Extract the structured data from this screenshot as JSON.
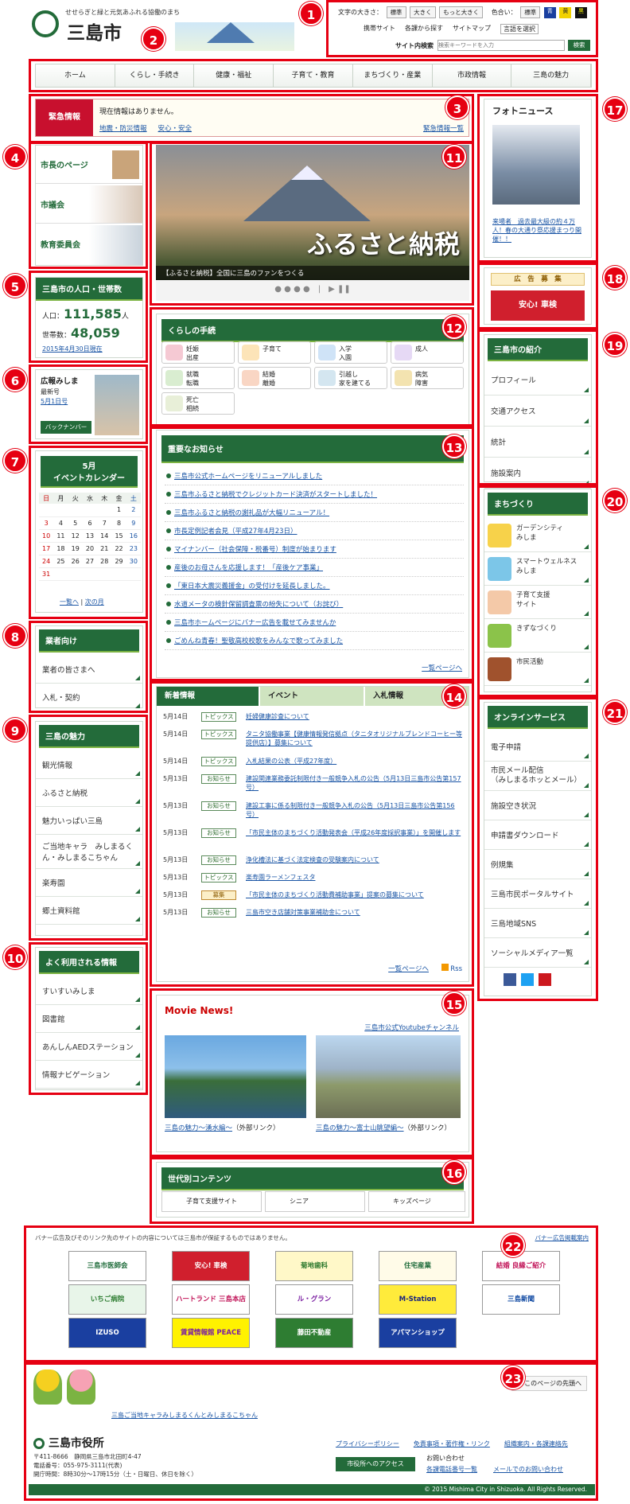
{
  "header": {
    "tagline": "せせらぎと緑と元気あふれる協働のまち",
    "site_name": "三島市",
    "font_size_label": "文字の大きさ：",
    "font_buttons": [
      "標準",
      "大きく",
      "もっと大きく"
    ],
    "color_label": "色合い：",
    "color_buttons": [
      "標準",
      "青",
      "黄",
      "黒"
    ],
    "links": [
      "携帯サイト",
      "各課から探す",
      "サイトマップ",
      "言語を選択"
    ],
    "search_label": "サイト内検索",
    "search_placeholder": "検索キーワードを入力",
    "search_button": "検索"
  },
  "nav": [
    "ホーム",
    "くらし・手続き",
    "健康・福祉",
    "子育て・教育",
    "まちづくり・産業",
    "市政情報",
    "三島の魅力"
  ],
  "emergency": {
    "label": "緊急情報",
    "message": "現在情報はありません。",
    "links": [
      "地震・防災情報",
      "安心・安全"
    ],
    "list_link": "緊急情報一覧"
  },
  "left": {
    "mayor": [
      "市長のページ",
      "市議会",
      "教育委員会"
    ],
    "population": {
      "title": "三島市の人口・世帯数",
      "pop_label": "人口：",
      "pop_value": "111,585",
      "pop_unit": "人",
      "hh_label": "世帯数：",
      "hh_value": "48,059",
      "date": "2015年4月30日現在"
    },
    "koho": {
      "title": "広報みしま",
      "latest": "最新号",
      "issue": "5月1日号",
      "backnumber": "バックナンバー"
    },
    "calendar": {
      "title_month": "5月",
      "title": "イベントカレンダー",
      "days": [
        "日",
        "月",
        "火",
        "水",
        "木",
        "金",
        "土"
      ],
      "weeks": [
        [
          "",
          "",
          "",
          "",
          "",
          "1",
          "2"
        ],
        [
          "3",
          "4",
          "5",
          "6",
          "7",
          "8",
          "9"
        ],
        [
          "10",
          "11",
          "12",
          "13",
          "14",
          "15",
          "16"
        ],
        [
          "17",
          "18",
          "19",
          "20",
          "21",
          "22",
          "23"
        ],
        [
          "24",
          "25",
          "26",
          "27",
          "28",
          "29",
          "30"
        ],
        [
          "31",
          "",
          "",
          "",
          "",
          "",
          ""
        ]
      ],
      "list": "一覧へ",
      "next": "次の月"
    },
    "business": {
      "title": "業者向け",
      "items": [
        "業者の皆さまへ",
        "入札・契約"
      ]
    },
    "charm": {
      "title": "三島の魅力",
      "items": [
        "観光情報",
        "ふるさと納税",
        "魅力いっぱい三島",
        "ご当地キャラ　みしまるくん・みしまるこちゃん",
        "楽寿園",
        "郷土資料館"
      ]
    },
    "popular": {
      "title": "よく利用される情報",
      "items": [
        "すいすいみしま",
        "図書館",
        "あんしんAEDステーション",
        "情報ナビゲーション"
      ]
    }
  },
  "slider": {
    "big_text": "ふるさと納税",
    "caption": "【ふるさと納税】全国に三島のファンをつくる"
  },
  "procedures": {
    "title": "くらしの手続",
    "items": [
      "妊娠\n出産",
      "子育て",
      "入学\n入園",
      "成人",
      "就職\n転職",
      "結婚\n離婚",
      "引越し\n家を建てる",
      "病気\n障害",
      "死亡\n相続"
    ]
  },
  "important": {
    "title": "重要なお知らせ",
    "items": [
      "三島市公式ホームページをリニューアルしました",
      "三島市ふるさと納税でクレジットカード決済がスタートしました！",
      "三島市ふるさと納税の謝礼品が大幅リニューアル！",
      "市長定例記者会見（平成27年4月23日）",
      "マイナンバー（社会保障・税番号）制度が始まります",
      "産後のお母さんを応援します！「産後ケア事業」",
      "「東日本大震災義援金」の受付けを延長しました。",
      "水道メータの検針保留調査票の紛失について（お詫び）",
      "三島市ホームページにバナー広告を載せてみませんか",
      "ごめんね青春！聖敬高校校歌をみんなで歌ってみました"
    ],
    "more": "一覧ページへ"
  },
  "whatsnew": {
    "tabs": [
      "新着情報",
      "イベント",
      "入札情報"
    ],
    "rows": [
      {
        "date": "5月14日",
        "tag": "トピックス",
        "text": "妊婦健康診査について"
      },
      {
        "date": "5月14日",
        "tag": "トピックス",
        "text": "タニタ協働事業【健康情報発信拠点（タニタオリジナルブレンドコーヒー等提供店）】募集について"
      },
      {
        "date": "5月14日",
        "tag": "トピックス",
        "text": "入札結果の公表（平成27年度）"
      },
      {
        "date": "5月13日",
        "tag": "お知らせ",
        "text": "建設関連業務委託制限付き一般競争入札の公告（5月13日三島市公告第157号）"
      },
      {
        "date": "5月13日",
        "tag": "お知らせ",
        "text": "建設工事に係る制限付き一般競争入札の公告（5月13日三島市公告第156号）"
      },
      {
        "date": "5月13日",
        "tag": "お知らせ",
        "text": "「市民主体のまちづくり活動発表会（平成26年度採択事業）」を開催します"
      },
      {
        "date": "5月13日",
        "tag": "お知らせ",
        "text": "浄化槽法に基づく法定検査の受験案内について"
      },
      {
        "date": "5月13日",
        "tag": "トピックス",
        "text": "楽寿園ラーメンフェスタ"
      },
      {
        "date": "5月13日",
        "tag": "募集",
        "text": "「市民主体のまちづくり活動費補助事業」提案の募集について"
      },
      {
        "date": "5月13日",
        "tag": "お知らせ",
        "text": "三島市空き店舗対策事業補助金について"
      }
    ],
    "more": "一覧ページへ",
    "rss": "Rss"
  },
  "movie": {
    "title": "Movie News!",
    "channel": "三島市公式Youtubeチャンネル",
    "items": [
      {
        "title": "三島の魅力～湧水編～",
        "ext": "（外部リンク）"
      },
      {
        "title": "三島の魅力～富士山眺望編～",
        "ext": "（外部リンク）"
      }
    ]
  },
  "generation": {
    "title": "世代別コンテンツ",
    "items": [
      "子育て支援サイト",
      "シニア",
      "キッズページ"
    ]
  },
  "right": {
    "photo": {
      "title": "フォトニュース",
      "caption": "来場者　過去最大級の約４万人！春の大通り祭応援まつり開催！！"
    },
    "ad": {
      "title": "広　告　募　集"
    },
    "intro": {
      "title": "三島市の紹介",
      "items": [
        "プロフィール",
        "交通アクセス",
        "統計",
        "施設案内"
      ]
    },
    "machi": {
      "title": "まちづくり",
      "items": [
        "ガーデンシティ\nみしま",
        "スマートウェルネス\nみしま",
        "子育て支援\nサイト",
        "きずなづくり",
        "市民活動"
      ]
    },
    "online": {
      "title": "オンラインサービス",
      "items": [
        "電子申請",
        "市民メール配信\n（みしまるホッとメール）",
        "施設空き状況",
        "申請書ダウンロード",
        "例規集",
        "三島市民ポータルサイト",
        "三島地域SNS",
        "ソーシャルメディア一覧"
      ]
    }
  },
  "banners": {
    "notice": "バナー広告及びそのリンク先のサイトの内容については三島市が保証するものではありません。",
    "link": "バナー広告掲載案内",
    "items": [
      "三島市医師会",
      "安心! 車検",
      "菊地歯科",
      "住宅産業",
      "結婚 良縁ご紹介",
      "いちご病院",
      "ハートランド 三島本店",
      "ル・グラン",
      "M-Station",
      "三島新聞",
      "IZUSO",
      "賃貸情報館 PEACE",
      "藤田不動産",
      "アパマンショップ"
    ]
  },
  "footer": {
    "top_link": "このページの先頭へ",
    "chara": "三島ご当地キャラみしまるくんとみしまるこちゃん",
    "office": "三島市役所",
    "postal": "〒411-8666　静岡県三島市北田町4-47",
    "tel": "電話番号：055-975-3111(代表)",
    "hours": "開庁時間：8時30分～17時15分（土・日曜日、休日を除く）",
    "links": [
      "プライバシーポリシー",
      "免責事項・著作権・リンク",
      "組織案内・各課連絡先"
    ],
    "access": "市役所へのアクセス",
    "contact": "お問い合わせ",
    "contact_links": [
      "各課電話番号一覧",
      "メールでのお問い合わせ"
    ],
    "copyright": "© 2015 Mishima City in Shizuoka. All Rights Reserved."
  },
  "markers": [
    "1",
    "2",
    "3",
    "4",
    "5",
    "6",
    "7",
    "8",
    "9",
    "10",
    "11",
    "12",
    "13",
    "14",
    "15",
    "16",
    "17",
    "18",
    "19",
    "20",
    "21",
    "22",
    "23"
  ],
  "colors": {
    "accent": "#236b3a",
    "marker": "#e60012"
  }
}
